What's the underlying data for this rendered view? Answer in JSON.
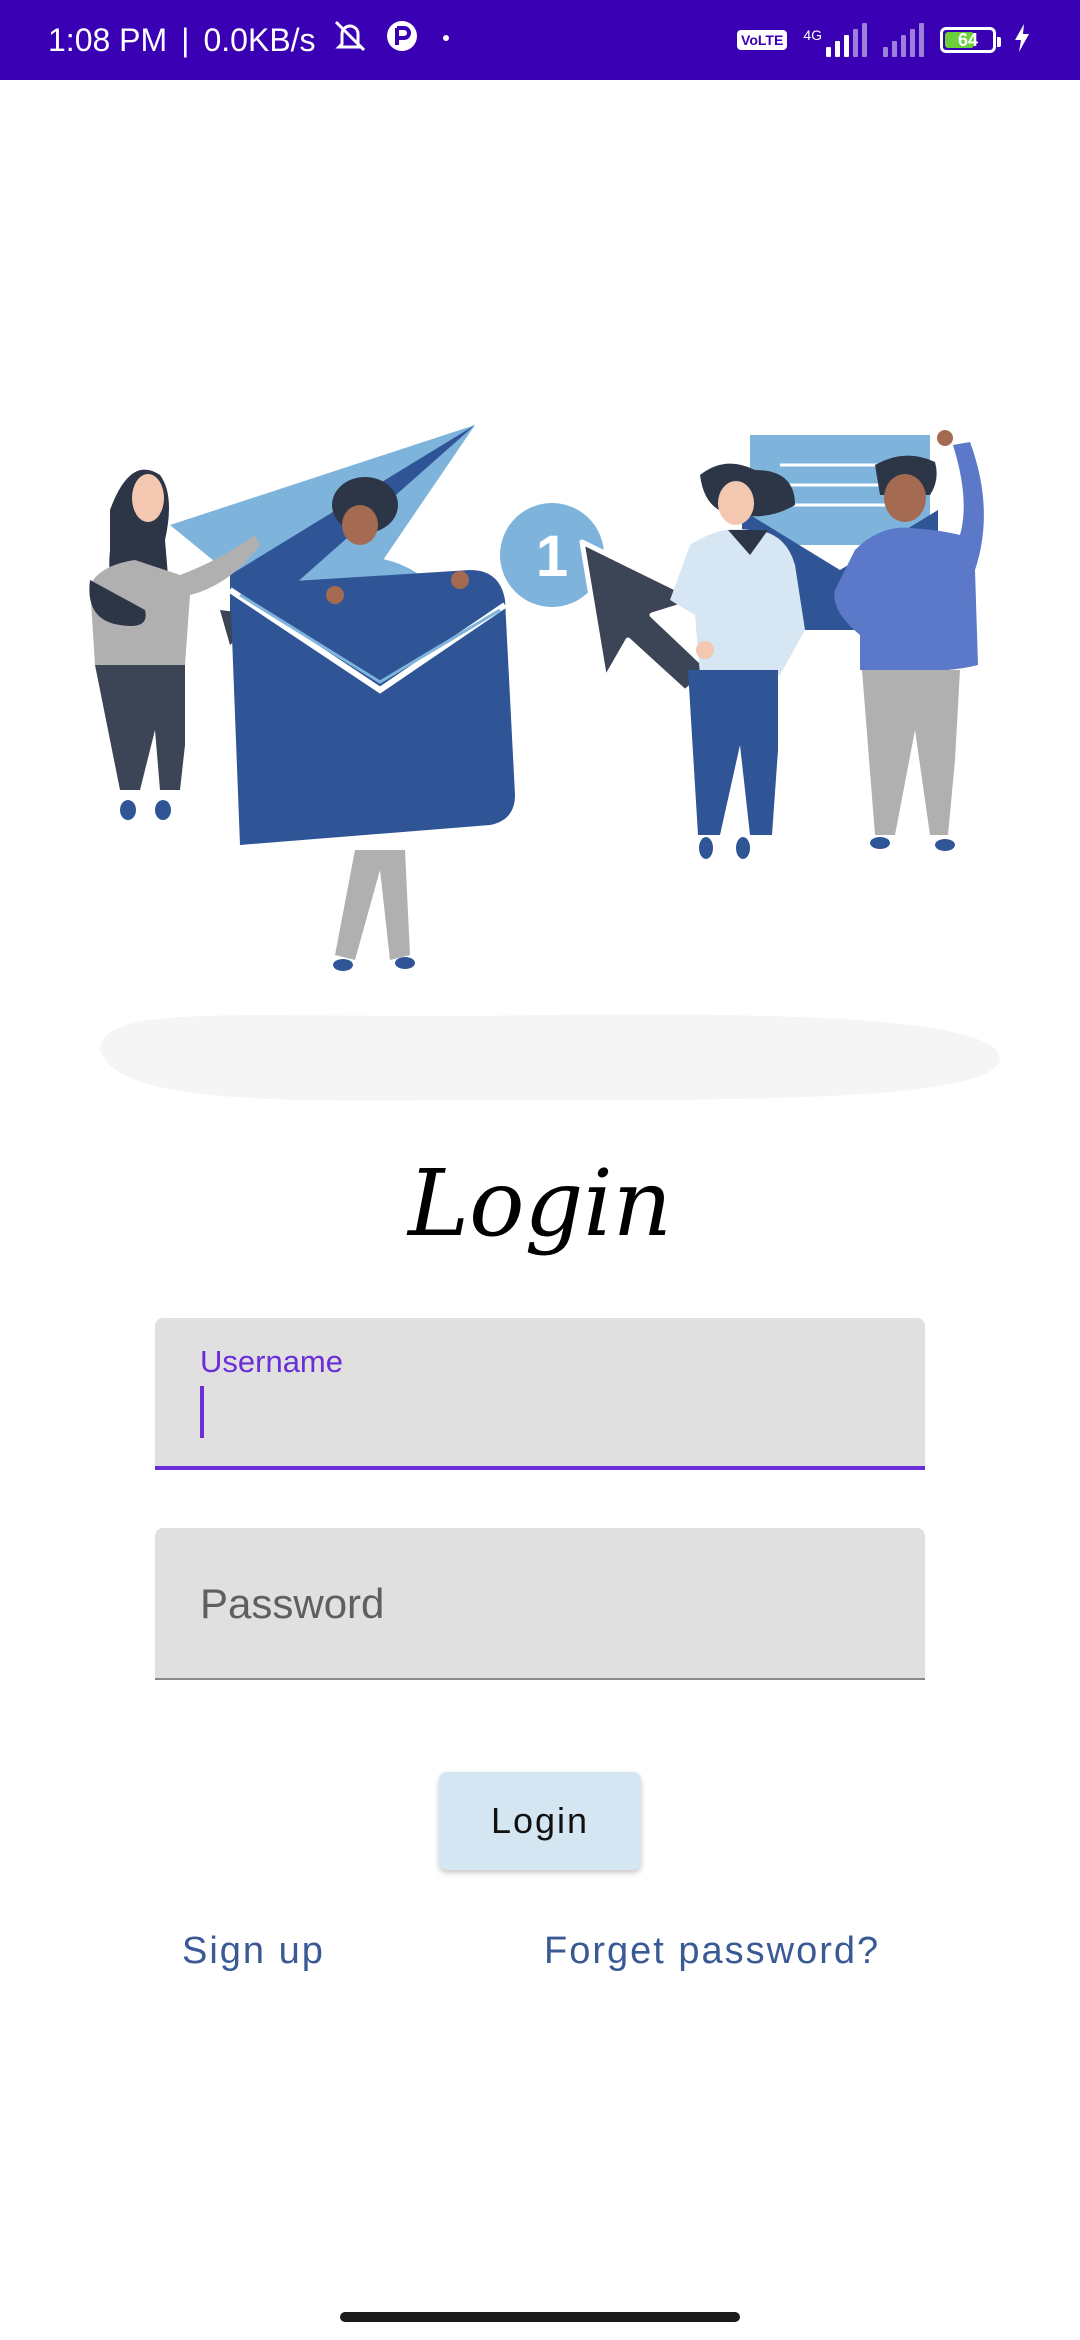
{
  "status_bar": {
    "time": "1:08 PM",
    "separator": "|",
    "net_speed": "0.0KB/s",
    "network_badge": "VoLTE",
    "network_type": "4G",
    "battery_level": 64,
    "battery_text": "64",
    "icons": [
      "mute-icon",
      "app-notification-icon",
      "dot-icon",
      "volte-icon",
      "signal-icon",
      "signal-icon-2",
      "battery-icon",
      "charging-icon"
    ]
  },
  "illustration": {
    "badge_number": "1"
  },
  "title": "Login",
  "form": {
    "username_label": "Username",
    "password_placeholder": "Password"
  },
  "buttons": {
    "login": "Login"
  },
  "links": {
    "signup": "Sign up",
    "forgot": "Forget password?"
  },
  "colors": {
    "status_bar": "#3a00b3",
    "accent": "#6b2ed6",
    "field_bg": "#e0e0e0",
    "button_bg": "#d4e6f2",
    "link": "#3a5a95"
  }
}
